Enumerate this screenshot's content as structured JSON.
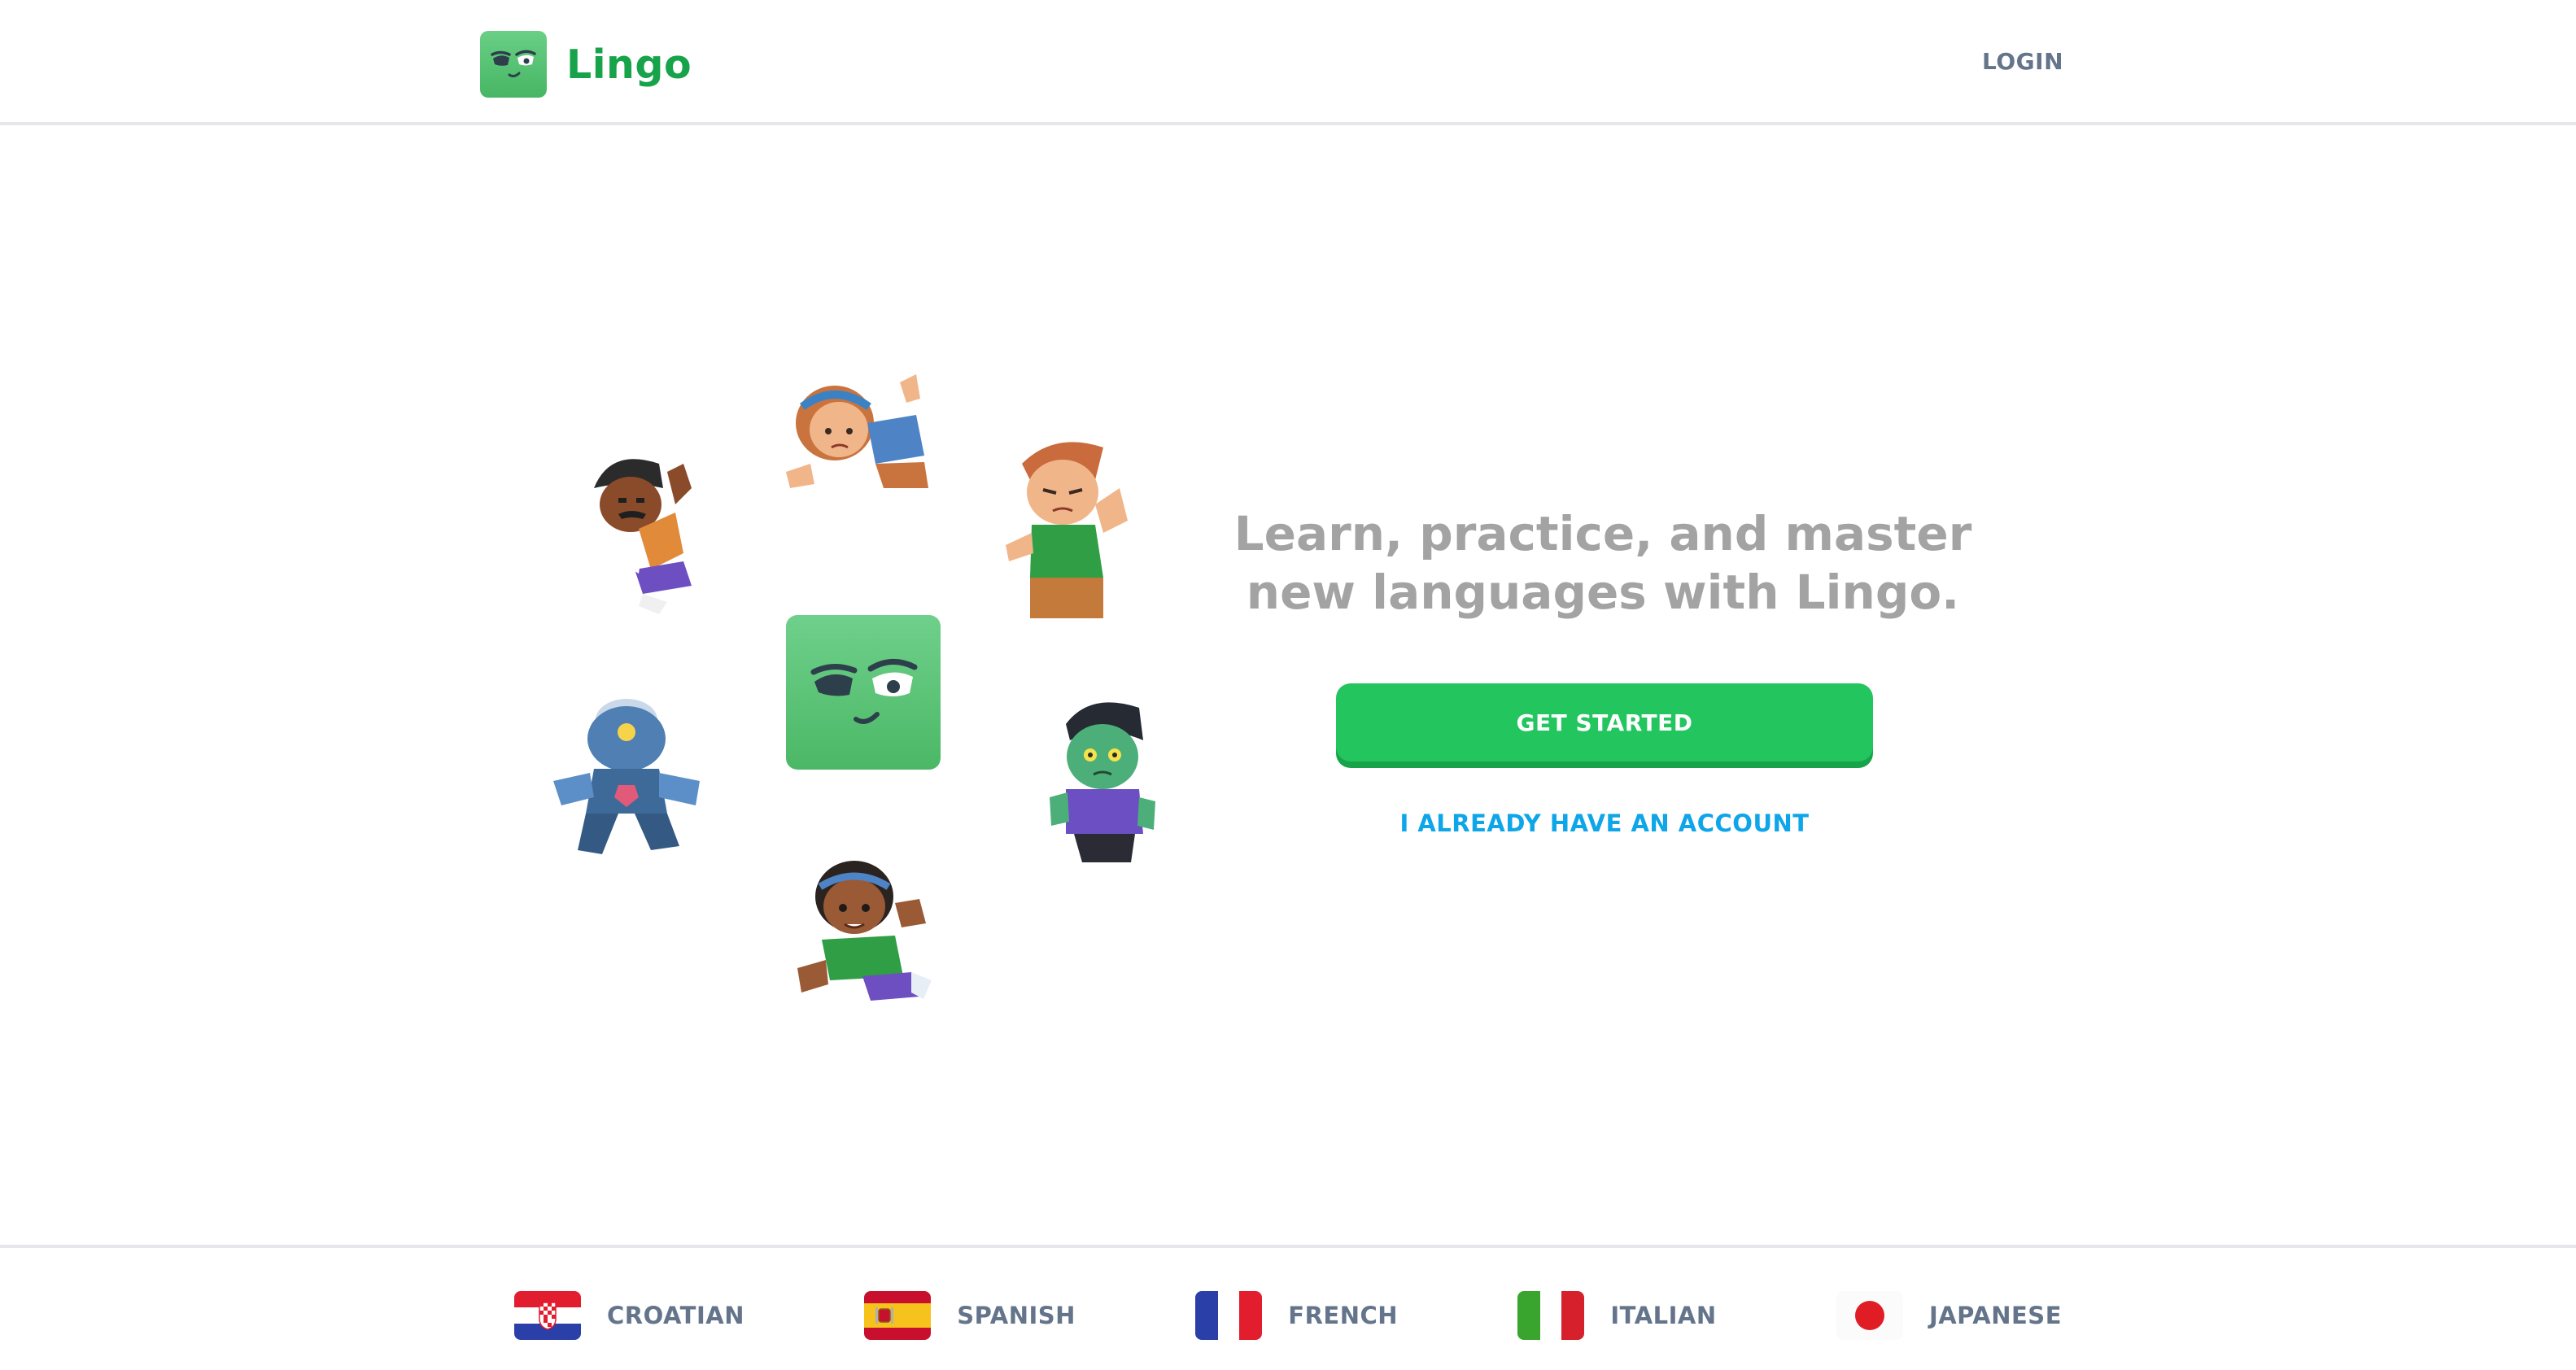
{
  "header": {
    "brand_name": "Lingo",
    "login_label": "LOGIN"
  },
  "hero": {
    "tagline": "Learn, practice, and master new languages with Lingo.",
    "get_started_label": "GET STARTED",
    "have_account_label": "I ALREADY HAVE AN ACCOUNT",
    "characters": [
      "man-character",
      "woman-character",
      "boy-character",
      "robot-character",
      "zombie-character",
      "girl-character"
    ]
  },
  "footer": {
    "languages": [
      {
        "label": "CROATIAN",
        "flag": "croatia-flag-icon"
      },
      {
        "label": "SPANISH",
        "flag": "spain-flag-icon"
      },
      {
        "label": "FRENCH",
        "flag": "france-flag-icon"
      },
      {
        "label": "ITALIAN",
        "flag": "italy-flag-icon"
      },
      {
        "label": "JAPANESE",
        "flag": "japan-flag-icon"
      }
    ]
  },
  "colors": {
    "brand_green": "#16a34a",
    "button_green": "#22c55e",
    "button_shadow": "#16a34a",
    "link_blue": "#0ea5e9",
    "muted_text": "#64748b",
    "tagline_gray": "#a3a3a3",
    "divider": "#e5e7eb"
  }
}
